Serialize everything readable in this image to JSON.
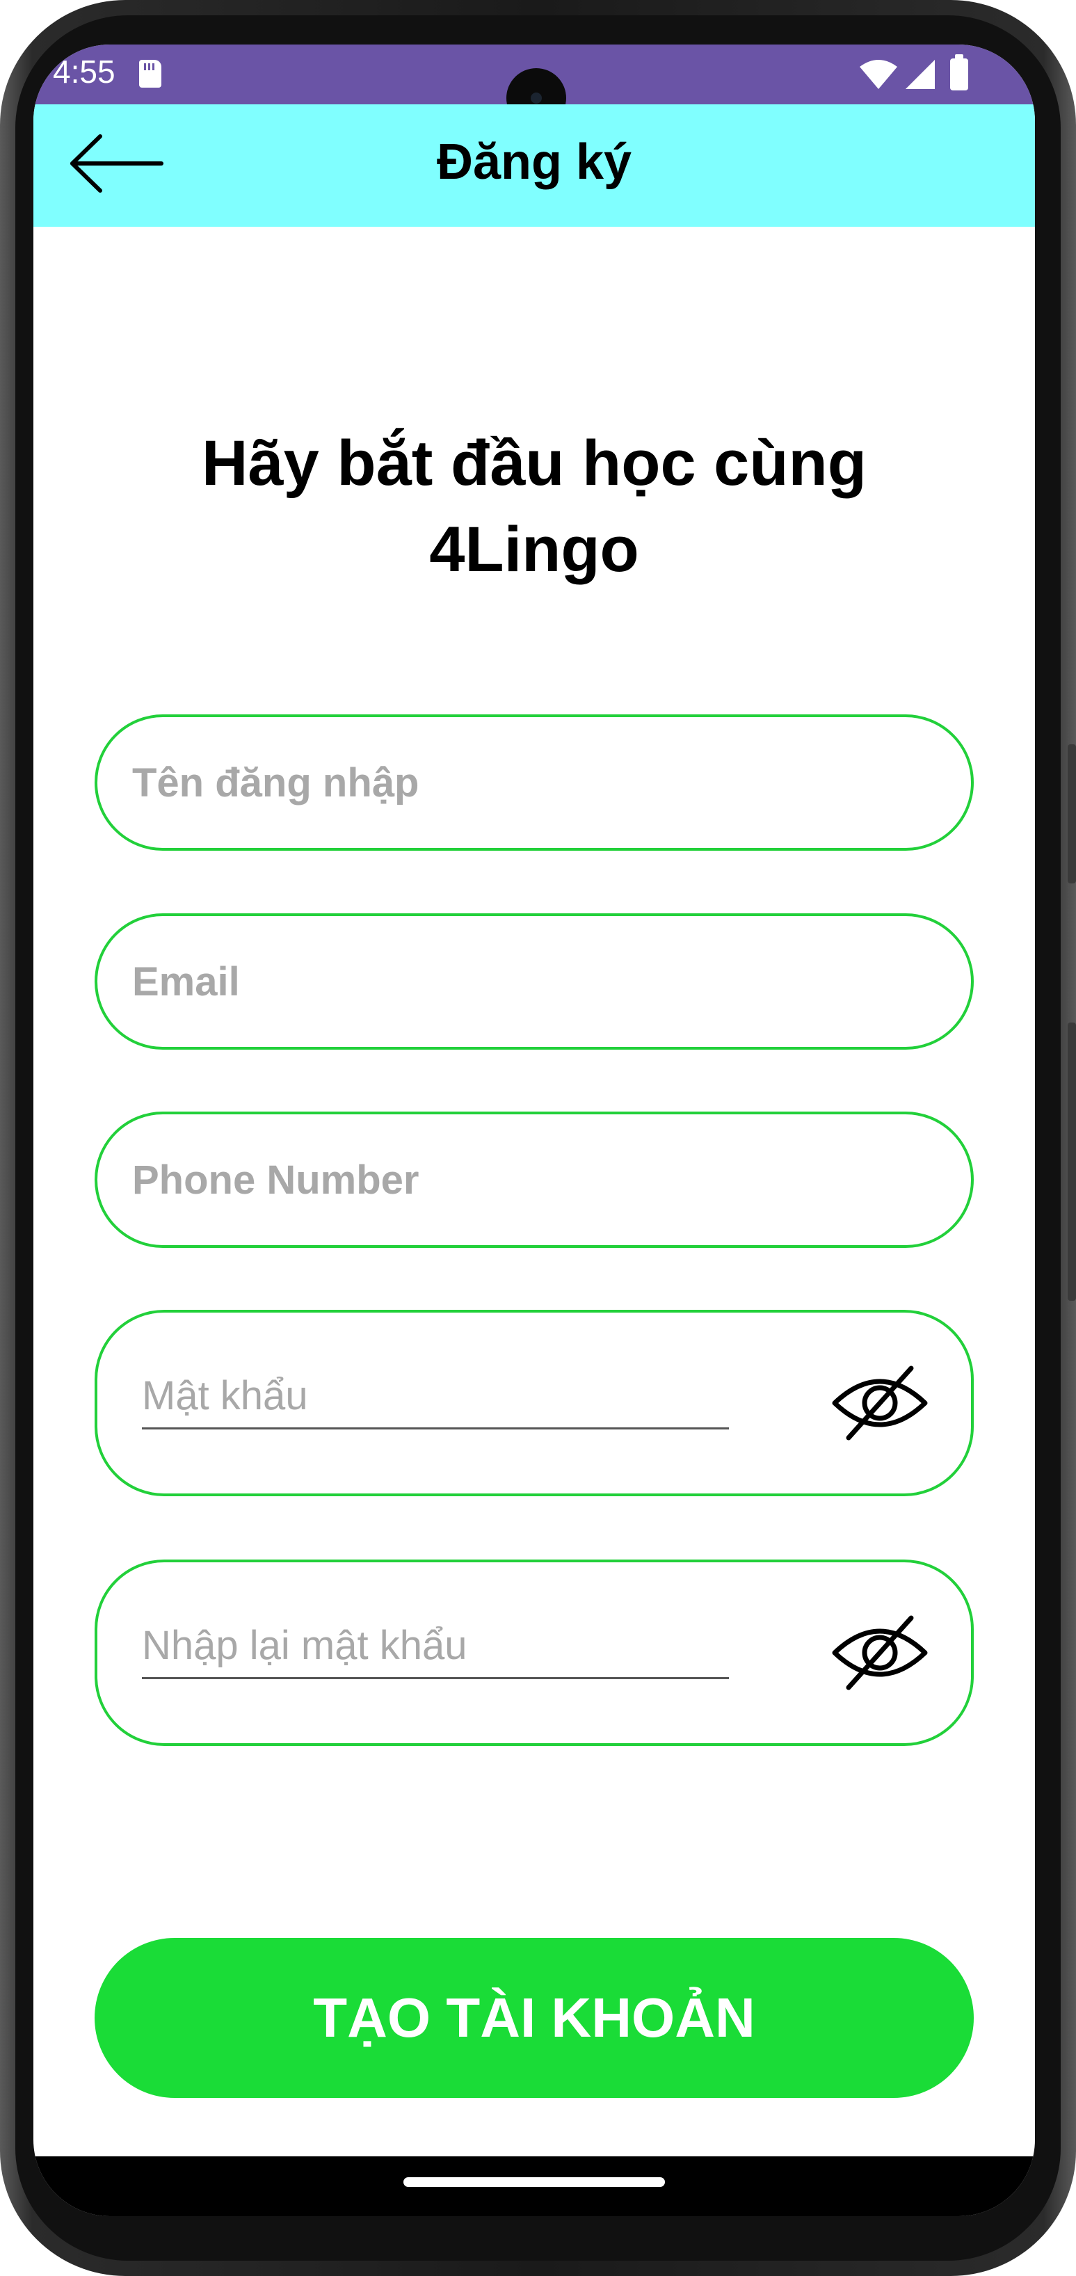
{
  "status_bar": {
    "time": "4:55",
    "icons": [
      "sd-card-icon",
      "wifi-icon",
      "signal-icon",
      "battery-icon"
    ],
    "background": "#6a54a6"
  },
  "app_bar": {
    "title": "Đăng ký",
    "back_icon": "arrow-left-icon",
    "background": "#80ffff"
  },
  "heading": "Hãy bắt đầu học cùng 4Lingo",
  "form": {
    "username_placeholder": "Tên đăng nhập",
    "email_placeholder": "Email",
    "phone_placeholder": "Phone Number",
    "password_placeholder": "Mật khẩu",
    "confirm_password_placeholder": "Nhập lại mật khẩu",
    "password_toggle_icon": "eye-off-icon",
    "border_color": "#22d03a"
  },
  "submit": {
    "label": "TẠO TÀI KHOẢN",
    "background": "#1adc37"
  }
}
